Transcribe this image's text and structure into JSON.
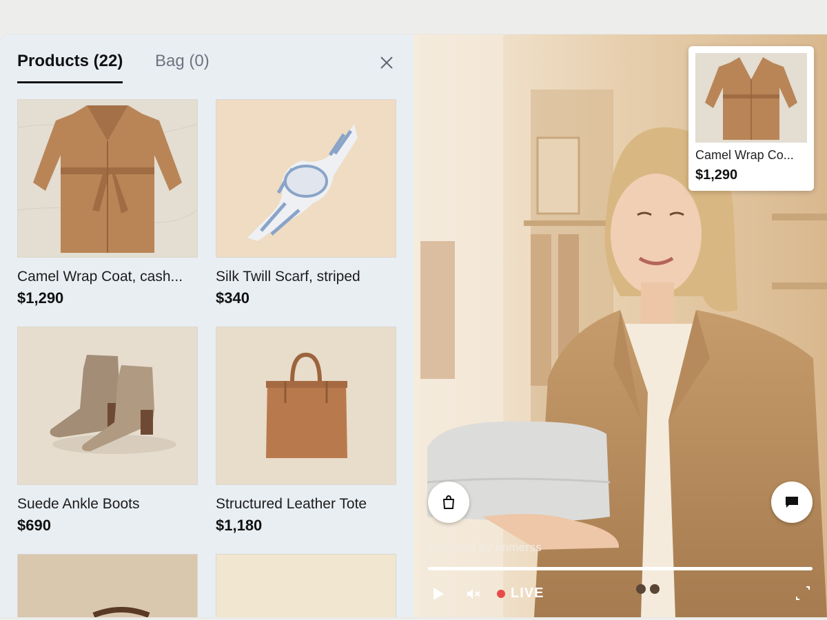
{
  "tabs": {
    "products_label": "Products (22)",
    "bag_label": "Bag (0)"
  },
  "products": [
    {
      "title": "Camel Wrap Coat, cash...",
      "price": "$1,290",
      "image": "camel-coat"
    },
    {
      "title": "Silk Twill Scarf, striped",
      "price": "$340",
      "image": "striped-scarf"
    },
    {
      "title": "Suede Ankle Boots",
      "price": "$690",
      "image": "ankle-boots"
    },
    {
      "title": "Structured Leather Tote",
      "price": "$1,180",
      "image": "leather-tote"
    }
  ],
  "featured": {
    "title": "Camel Wrap Co...",
    "price": "$1,290"
  },
  "player": {
    "powered_by": "Powered by Immerss",
    "live_label": "LIVE",
    "progress": 1.0
  },
  "icons": {
    "close": "close-icon",
    "bag": "shopping-bag-icon",
    "chat": "chat-bubble-icon",
    "play": "play-icon",
    "mute": "mute-icon",
    "fullscreen": "fullscreen-icon"
  },
  "colors": {
    "panel_bg": "#e9eef3",
    "live_dot": "#e84a4a",
    "tab_active": "#111111",
    "tab_inactive": "#6b7480"
  }
}
